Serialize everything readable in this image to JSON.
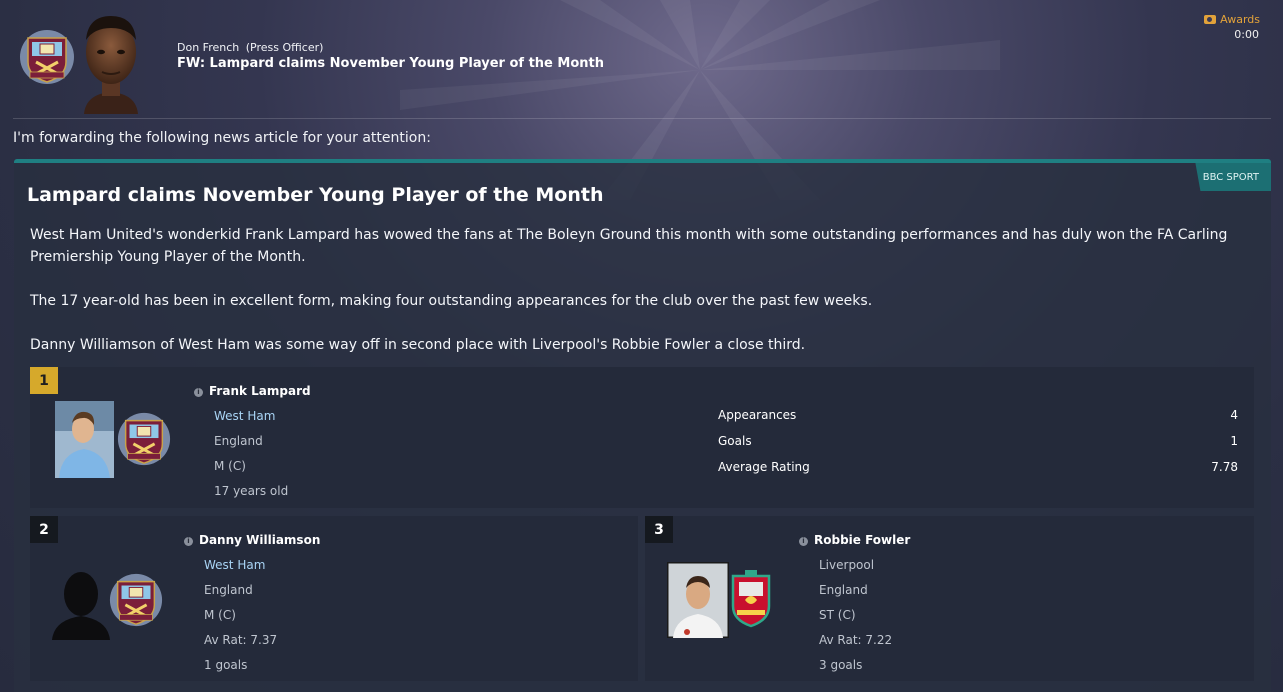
{
  "header": {
    "sender_name": "Don French",
    "sender_role": "(Press Officer)",
    "subject": "FW: Lampard claims November Young Player of the Month",
    "awards_label": "Awards",
    "time": "0:00"
  },
  "intro": "I'm forwarding the following news article for your attention:",
  "article": {
    "source": "BBC SPORT",
    "title": "Lampard claims November Young Player of the Month",
    "paragraphs": [
      "West Ham United's wonderkid Frank Lampard has wowed the fans at The Boleyn Ground this month with some outstanding performances and has duly won the FA Carling Premiership Young Player of the Month.",
      "The 17 year-old has been in excellent form, making four outstanding appearances for the club over the past few weeks.",
      "Danny Williamson of West Ham was some way off in second place with Liverpool's Robbie Fowler a close third."
    ]
  },
  "winner": {
    "rank": "1",
    "name": "Frank Lampard",
    "club": "West Ham",
    "nation": "England",
    "position": "M (C)",
    "age": "17 years old",
    "stats": [
      {
        "label": "Appearances",
        "value": "4"
      },
      {
        "label": "Goals",
        "value": "1"
      },
      {
        "label": "Average Rating",
        "value": "7.78"
      }
    ]
  },
  "second": {
    "rank": "2",
    "name": "Danny Williamson",
    "club": "West Ham",
    "nation": "England",
    "position": "M (C)",
    "rating": "Av Rat: 7.37",
    "goals": "1 goals"
  },
  "third": {
    "rank": "3",
    "name": "Robbie Fowler",
    "club": "Liverpool",
    "nation": "England",
    "position": "ST (C)",
    "rating": "Av Rat: 7.22",
    "goals": "3 goals"
  },
  "colors": {
    "accent_teal": "#1f7f82",
    "gold_rank": "#d6a92b",
    "awards_orange": "#e2a23a",
    "club_link": "#a9d4f5"
  }
}
